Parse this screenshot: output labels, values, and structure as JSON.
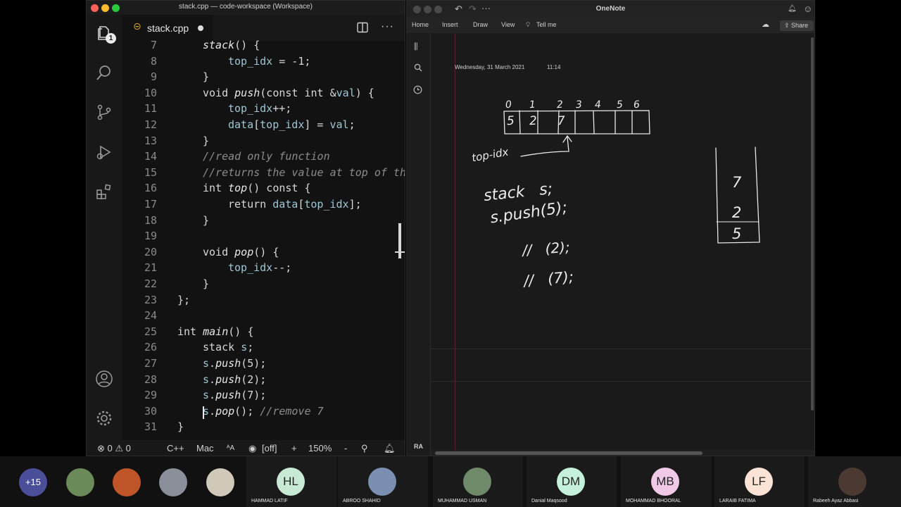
{
  "vscode": {
    "window_title": "stack.cpp — code-workspace (Workspace)",
    "tab_label": "stack.cpp",
    "explorer_badge": "1",
    "lines": [
      {
        "n": "7",
        "indent": 1,
        "tokens": [
          [
            "fn",
            "stack"
          ],
          [
            "kw",
            "() {"
          ]
        ]
      },
      {
        "n": "8",
        "indent": 2,
        "tokens": [
          [
            "var",
            "top_idx"
          ],
          [
            "kw",
            " = -1;"
          ]
        ]
      },
      {
        "n": "9",
        "indent": 1,
        "tokens": [
          [
            "kw",
            "}"
          ]
        ]
      },
      {
        "n": "10",
        "indent": 1,
        "tokens": [
          [
            "kw",
            "void "
          ],
          [
            "fn",
            "push"
          ],
          [
            "kw",
            "(const int &"
          ],
          [
            "var",
            "val"
          ],
          [
            "kw",
            ") {"
          ]
        ]
      },
      {
        "n": "11",
        "indent": 2,
        "tokens": [
          [
            "var",
            "top_idx"
          ],
          [
            "kw",
            "++;"
          ]
        ]
      },
      {
        "n": "12",
        "indent": 2,
        "tokens": [
          [
            "var",
            "data"
          ],
          [
            "kw",
            "["
          ],
          [
            "var",
            "top_idx"
          ],
          [
            "kw",
            "] = "
          ],
          [
            "var",
            "val"
          ],
          [
            "kw",
            ";"
          ]
        ]
      },
      {
        "n": "13",
        "indent": 1,
        "tokens": [
          [
            "kw",
            "}"
          ]
        ]
      },
      {
        "n": "14",
        "indent": 1,
        "tokens": [
          [
            "cm",
            "//read only function"
          ]
        ]
      },
      {
        "n": "15",
        "indent": 1,
        "tokens": [
          [
            "cm",
            "//returns the value at top of th"
          ]
        ]
      },
      {
        "n": "16",
        "indent": 1,
        "tokens": [
          [
            "kw",
            "int "
          ],
          [
            "fn",
            "top"
          ],
          [
            "kw",
            "() const {"
          ]
        ]
      },
      {
        "n": "17",
        "indent": 2,
        "tokens": [
          [
            "kw",
            "return "
          ],
          [
            "var",
            "data"
          ],
          [
            "kw",
            "["
          ],
          [
            "var",
            "top_idx"
          ],
          [
            "kw",
            "];"
          ]
        ]
      },
      {
        "n": "18",
        "indent": 1,
        "tokens": [
          [
            "kw",
            "}"
          ]
        ]
      },
      {
        "n": "19",
        "indent": 0,
        "tokens": []
      },
      {
        "n": "20",
        "indent": 1,
        "tokens": [
          [
            "kw",
            "void "
          ],
          [
            "fn",
            "pop"
          ],
          [
            "kw",
            "() {"
          ]
        ]
      },
      {
        "n": "21",
        "indent": 2,
        "tokens": [
          [
            "var",
            "top_idx"
          ],
          [
            "kw",
            "--;"
          ]
        ]
      },
      {
        "n": "22",
        "indent": 1,
        "tokens": [
          [
            "kw",
            "}"
          ]
        ]
      },
      {
        "n": "23",
        "indent": 0,
        "tokens": [
          [
            "kw",
            "};"
          ]
        ]
      },
      {
        "n": "24",
        "indent": 0,
        "tokens": []
      },
      {
        "n": "25",
        "indent": 0,
        "tokens": [
          [
            "kw",
            "int "
          ],
          [
            "fn",
            "main"
          ],
          [
            "kw",
            "() {"
          ]
        ]
      },
      {
        "n": "26",
        "indent": 1,
        "tokens": [
          [
            "kw",
            "stack "
          ],
          [
            "var",
            "s"
          ],
          [
            "kw",
            ";"
          ]
        ]
      },
      {
        "n": "27",
        "indent": 1,
        "tokens": [
          [
            "var",
            "s"
          ],
          [
            "kw",
            "."
          ],
          [
            "fn",
            "push"
          ],
          [
            "kw",
            "(5);"
          ]
        ]
      },
      {
        "n": "28",
        "indent": 1,
        "tokens": [
          [
            "var",
            "s"
          ],
          [
            "kw",
            "."
          ],
          [
            "fn",
            "push"
          ],
          [
            "kw",
            "(2);"
          ]
        ]
      },
      {
        "n": "29",
        "indent": 1,
        "tokens": [
          [
            "var",
            "s"
          ],
          [
            "kw",
            "."
          ],
          [
            "fn",
            "push"
          ],
          [
            "kw",
            "(7);"
          ]
        ]
      },
      {
        "n": "30",
        "indent": 1,
        "tokens": [
          [
            "var",
            "s"
          ],
          [
            "kw",
            "."
          ],
          [
            "fn",
            "pop"
          ],
          [
            "kw",
            "(); "
          ],
          [
            "cm",
            "//remove 7"
          ]
        ]
      },
      {
        "n": "31",
        "indent": 0,
        "tokens": [
          [
            "kw",
            "}"
          ]
        ]
      }
    ],
    "status": {
      "problems": "⊗ 0 ⚠ 0",
      "language": "C++",
      "eol": "Mac",
      "font_glyph": "ᴬA",
      "copilot": "[off]",
      "plus": "+",
      "zoom": "150%",
      "minus": "-"
    }
  },
  "onenote": {
    "title": "OneNote",
    "ribbon": [
      "Home",
      "Insert",
      "Draw",
      "View"
    ],
    "tell_me": "Tell me",
    "share": "Share",
    "page_date": "Wednesday, 31 March 2021",
    "page_time": "11:14",
    "user_initials": "RA",
    "ink": {
      "indices": [
        "0",
        "1",
        "2",
        "3",
        "4",
        "5",
        "6"
      ],
      "cells": [
        "5",
        "2",
        "7",
        "",
        "",
        "",
        ""
      ],
      "pointer_label": "top-idx",
      "code_lines": [
        "stack   s;",
        "s.push(5);",
        "//   (2);",
        "//   (7);"
      ],
      "stack_items": [
        "7",
        "2",
        "5"
      ]
    }
  },
  "participants": {
    "overflow": "+15",
    "people": [
      {
        "initials": "",
        "name": "",
        "color": "#6b8a5a"
      },
      {
        "initials": "",
        "name": "",
        "color": "#c0552a"
      },
      {
        "initials": "",
        "name": "",
        "color": "#8a8f9a"
      },
      {
        "initials": "",
        "name": "",
        "color": "#d0c8b8"
      },
      {
        "initials": "HL",
        "name": "HAMMAD LATIF",
        "color": "#c8ead5"
      },
      {
        "initials": "",
        "name": "ABROO SHAHID",
        "color": "#7b8fb0"
      },
      {
        "initials": "",
        "name": "MUHAMMAD USMAN",
        "color": "#6f8a68"
      },
      {
        "initials": "DM",
        "name": "Danial Maqsood",
        "color": "#c4f0dc"
      },
      {
        "initials": "MB",
        "name": "MOHAMMAD BHOORAL",
        "color": "#f0c8e8"
      },
      {
        "initials": "LF",
        "name": "LARAIB FATIMA",
        "color": "#fbe3d6"
      },
      {
        "initials": "",
        "name": "Rabeeh Ayaz Abbasi",
        "color": "#4a3a32"
      }
    ]
  }
}
